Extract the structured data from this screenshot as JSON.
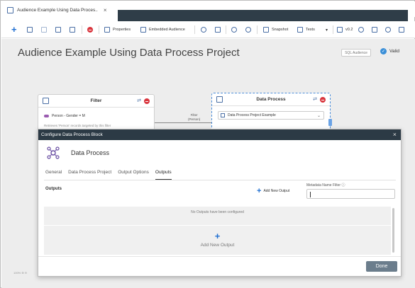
{
  "tab": {
    "title": "Audience Example Using Data Proces..",
    "close": "×"
  },
  "toolbar": {
    "properties_label": "Properties",
    "embedded_label": "Embedded Audience",
    "snapshot_label": "Snapshot",
    "tests_label": "Tests",
    "version_label": "v0.2"
  },
  "page": {
    "title": "Audience Example Using Data Process Project",
    "sql_label": "SQL Audience",
    "valid_label": "Valid"
  },
  "filter_node": {
    "title": "Filter",
    "row": "Person - Gender = M",
    "sub": "Retrieves 'Person' records targeted by this filter"
  },
  "connector": {
    "line1": "Filter",
    "line2": "(Person)"
  },
  "dp_node": {
    "title": "Data Process",
    "select_value": "Data Process Project Example"
  },
  "canvas": {
    "zoom": "100% ⊕ ⊖"
  },
  "dialog": {
    "title": "Configure Data Process Block",
    "block_name": "Data Process",
    "tabs": [
      "General",
      "Data Process Project",
      "Output Options",
      "Outputs"
    ],
    "outputs_label": "Outputs",
    "add_output_label": "Add New Output",
    "metadata_label": "Metadata Name Filter ⓘ",
    "no_outputs": "No Outputs have been configured",
    "add_big_label": "Add New Output",
    "done_label": "Done"
  },
  "colors": {
    "accent": "#1f6fd1",
    "dialog_header": "#2c3a45",
    "done_button": "#6b7d8c",
    "danger": "#d9363e"
  }
}
